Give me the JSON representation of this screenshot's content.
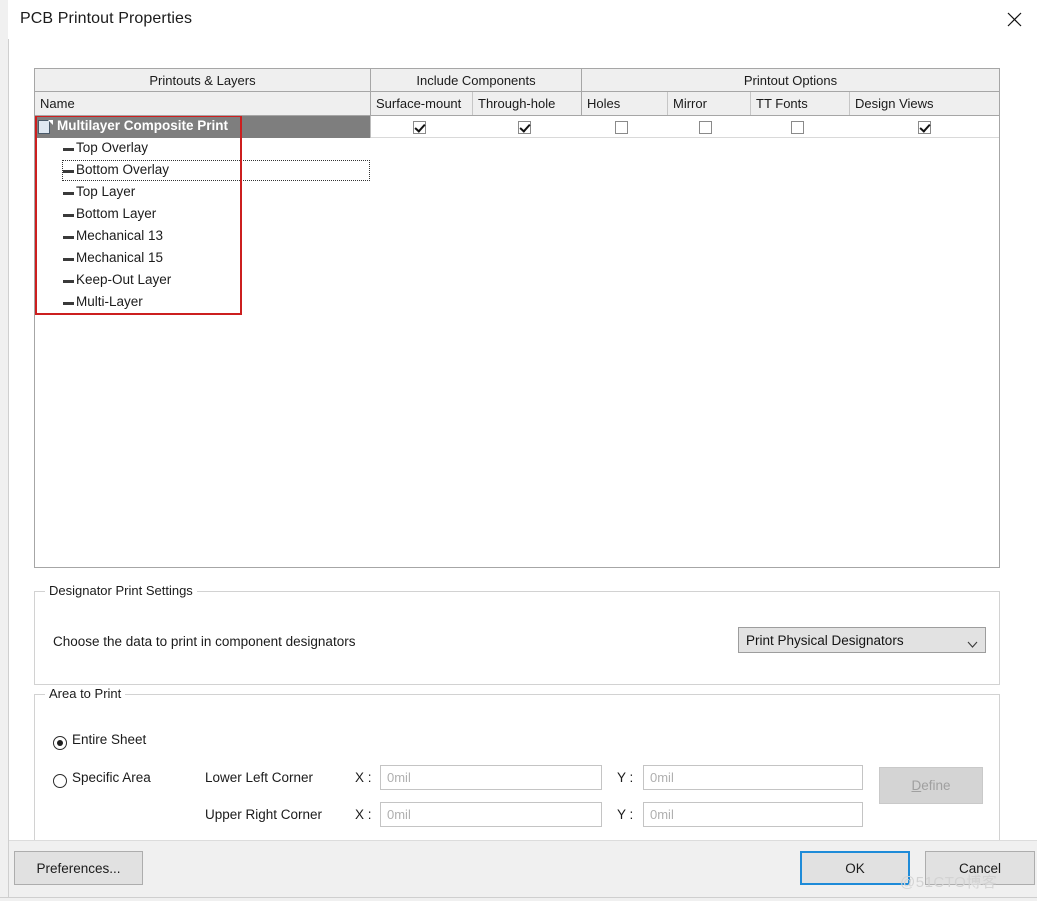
{
  "window": {
    "title": "PCB Printout Properties",
    "close_icon": "close-icon"
  },
  "table": {
    "groups": [
      {
        "label": "Printouts & Layers"
      },
      {
        "label": "Include Components"
      },
      {
        "label": "Printout Options"
      }
    ],
    "columns": [
      {
        "label": "Name"
      },
      {
        "label": "Surface-mount"
      },
      {
        "label": "Through-hole"
      },
      {
        "label": "Holes"
      },
      {
        "label": "Mirror"
      },
      {
        "label": "TT Fonts"
      },
      {
        "label": "Design Views"
      }
    ],
    "printout": {
      "name": "Multilayer Composite Print",
      "icon": "document-icon",
      "selected": true,
      "options": {
        "surface_mount": true,
        "through_hole": true,
        "holes": false,
        "mirror": false,
        "tt_fonts": false,
        "design_views": true
      }
    },
    "layers": [
      {
        "name": "Top Overlay"
      },
      {
        "name": "Bottom Overlay"
      },
      {
        "name": "Top Layer"
      },
      {
        "name": "Bottom Layer"
      },
      {
        "name": "Mechanical 13"
      },
      {
        "name": "Mechanical 15"
      },
      {
        "name": "Keep-Out Layer"
      },
      {
        "name": "Multi-Layer"
      }
    ],
    "focused_layer": "Bottom Overlay",
    "highlight_color": "#cc1f1f"
  },
  "designator": {
    "legend": "Designator Print Settings",
    "label": "Choose the data to print in component designators",
    "select_value": "Print Physical Designators",
    "caret_icon": "chevron-down-icon"
  },
  "area": {
    "legend": "Area to Print",
    "entire_sheet": "Entire Sheet",
    "specific_area": "Specific Area",
    "selected": "Entire Sheet",
    "lower_left_label": "Lower Left Corner",
    "upper_right_label": "Upper Right Corner",
    "x_label": "X :",
    "y_label": "Y :",
    "ll_x_value": "",
    "ll_x_placeholder": "0mil",
    "ll_y_value": "",
    "ll_y_placeholder": "0mil",
    "ur_x_value": "",
    "ur_x_placeholder": "0mil",
    "ur_y_value": "",
    "ur_y_placeholder": "0mil",
    "define_button_prefix": "D",
    "define_button_rest": "efine"
  },
  "footer": {
    "preferences": "Preferences...",
    "ok": "OK",
    "cancel": "Cancel",
    "accent": "#1e8bd8"
  },
  "watermark": "@51CTO博客"
}
